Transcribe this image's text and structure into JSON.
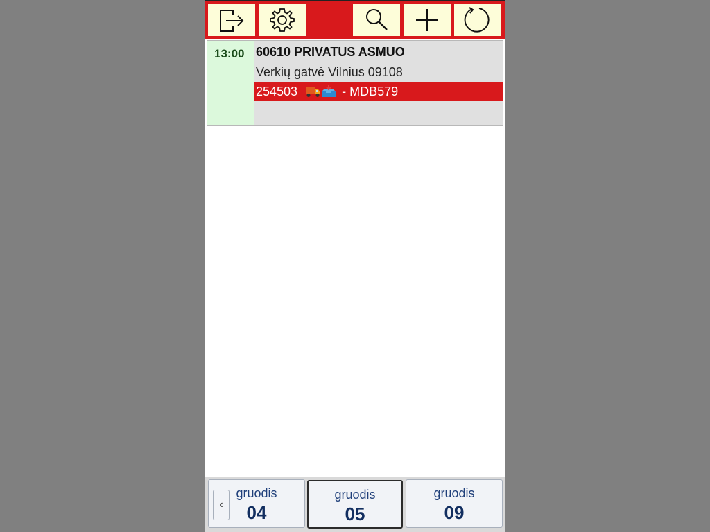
{
  "toolbar": {
    "buttons": [
      {
        "name": "logout",
        "icon": "logout-icon"
      },
      {
        "name": "settings",
        "icon": "gear-icon"
      },
      {
        "name": "search",
        "icon": "search-icon"
      },
      {
        "name": "add",
        "icon": "plus-icon"
      },
      {
        "name": "refresh",
        "icon": "refresh-icon"
      }
    ],
    "colors": {
      "bar": "#d8191c",
      "button": "#fdfdd9"
    }
  },
  "delivery": {
    "time": "13:00",
    "client": "60610 PRIVATUS ASMUO",
    "address": "Verkių gatvė Vilnius 09108",
    "order_number": "254503",
    "order_icons": [
      "delivery-truck-icon",
      "inbox-tray-icon"
    ],
    "vehicle": "- MDB579",
    "colors": {
      "time_bg": "#dcf9dc",
      "order_bar": "#d8191c"
    }
  },
  "calendar": {
    "prev_label": "‹",
    "days": [
      {
        "month": "gruodis",
        "day": "04",
        "active": false
      },
      {
        "month": "gruodis",
        "day": "05",
        "active": true
      },
      {
        "month": "gruodis",
        "day": "09",
        "active": false
      }
    ]
  }
}
